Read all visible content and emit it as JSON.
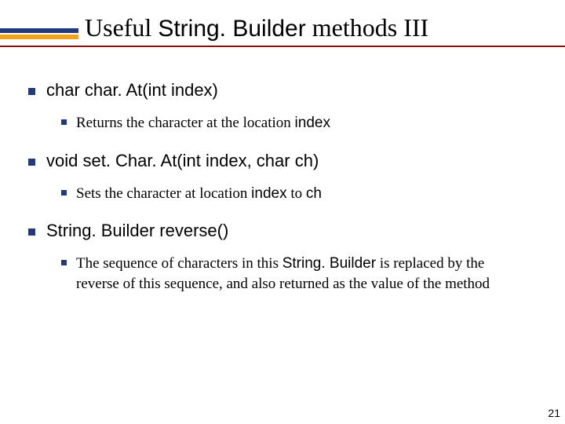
{
  "title": {
    "pre": "Useful ",
    "mid": "String. Builder",
    "post": " methods III"
  },
  "items": [
    {
      "heading": "char char. At(int index)",
      "sub_pre": "Returns the character at the location ",
      "sub_code": "index",
      "sub_post": ""
    },
    {
      "heading": "void set. Char. At(int index, char ch)",
      "sub_pre": "Sets the character at location ",
      "sub_code": "index",
      "sub_post_pre": " to ",
      "sub_code2": "ch",
      "sub_post": ""
    },
    {
      "heading": "String. Builder reverse()",
      "sub_pre": "The sequence of characters in this ",
      "sub_code": "String. Builder",
      "sub_post": " is replaced by the reverse of this sequence, and also returned as the value of the method"
    }
  ],
  "pagenum": "21"
}
